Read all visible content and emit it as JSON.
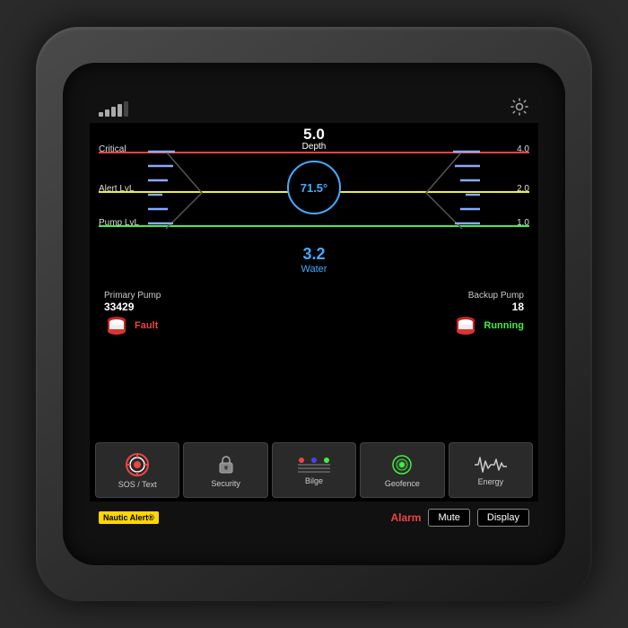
{
  "device": {
    "screen_bg": "#000"
  },
  "top_bar": {
    "settings_label": "⚙"
  },
  "gauge": {
    "depth_value": "5.0",
    "depth_label": "Depth",
    "angle_display": "71.5°",
    "water_value": "3.2",
    "water_label": "Water",
    "critical_label": "Critical",
    "critical_value": "4.0",
    "alert_label": "Alert LvL",
    "alert_value": "2.0",
    "pump_label": "Pump LvL",
    "pump_value": "1.0"
  },
  "pumps": {
    "primary": {
      "label": "Primary Pump",
      "count": "33429",
      "status": "Fault"
    },
    "backup": {
      "label": "Backup Pump",
      "count": "18",
      "status": "Running"
    }
  },
  "nav_buttons": [
    {
      "id": "sos",
      "label": "SOS / Text",
      "icon": "🆘"
    },
    {
      "id": "security",
      "label": "Security",
      "icon": "🔒"
    },
    {
      "id": "bilge",
      "label": "Bilge",
      "icon": "〰"
    },
    {
      "id": "geofence",
      "label": "Geofence",
      "icon": "🌀"
    },
    {
      "id": "energy",
      "label": "Energy",
      "icon": "∿"
    }
  ],
  "status_bar": {
    "brand": "Nautic Alert®",
    "alarm_label": "Alarm",
    "mute_label": "Mute",
    "display_label": "Display"
  }
}
